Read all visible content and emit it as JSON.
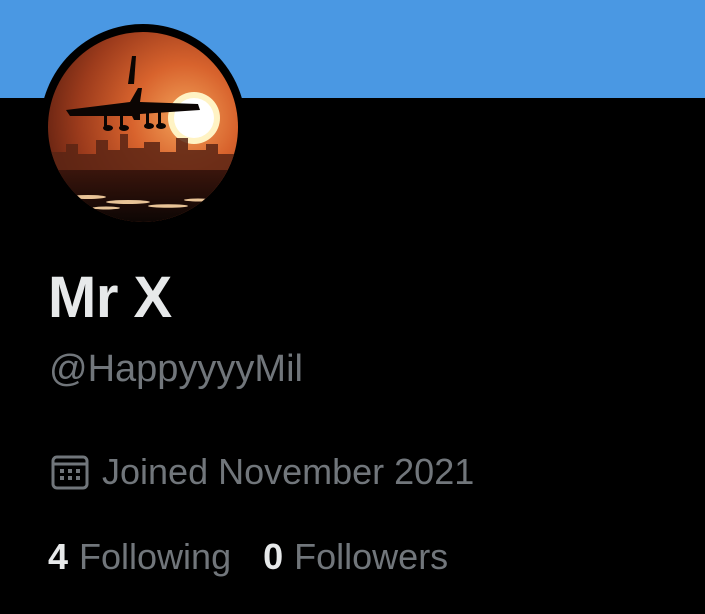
{
  "profile": {
    "banner_color": "#4a98e3",
    "avatar_icon": "airplane-sunset-avatar",
    "display_name": "Mr X",
    "handle": "@HappyyyyMil",
    "joined_icon": "calendar-icon",
    "joined": "Joined November 2021"
  },
  "stats": {
    "following_count": "4",
    "following_label": "Following",
    "followers_count": "0",
    "followers_label": "Followers"
  },
  "colors": {
    "background": "#000000",
    "primary_text": "#e7e9ea",
    "secondary_text": "#71767b"
  }
}
